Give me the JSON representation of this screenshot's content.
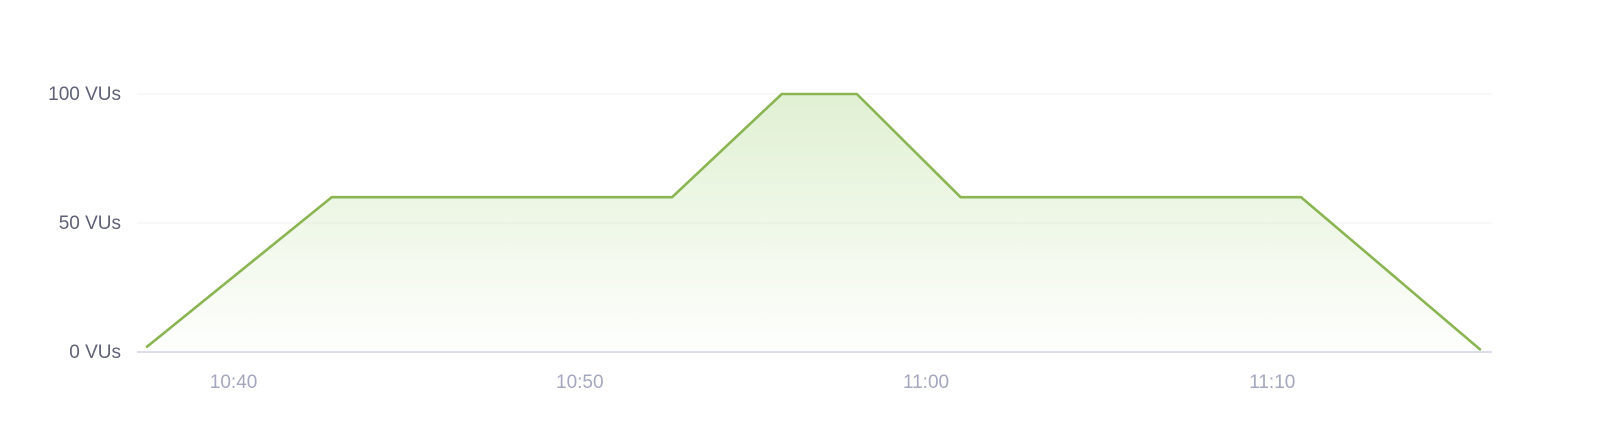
{
  "chart_data": {
    "type": "area",
    "title": "",
    "xlabel": "",
    "ylabel": "",
    "ylim": [
      0,
      100
    ],
    "y_ticks": [
      {
        "value": 0,
        "label": "0 VUs"
      },
      {
        "value": 50,
        "label": "50 VUs"
      },
      {
        "value": 100,
        "label": "100 VUs"
      }
    ],
    "x_ticks": [
      {
        "value": "10:40",
        "label": "10:40"
      },
      {
        "value": "10:50",
        "label": "10:50"
      },
      {
        "value": "11:00",
        "label": "11:00"
      },
      {
        "value": "11:10",
        "label": "11:10"
      }
    ],
    "xlim": [
      "10:37:30",
      "11:16:00"
    ],
    "grid": true,
    "legend": "none",
    "series": [
      {
        "color": "#8ab552",
        "fill_color": "#dbeecb",
        "points": [
          {
            "x": "10:37:30",
            "y": 2
          },
          {
            "x": "10:42:50",
            "y": 60
          },
          {
            "x": "10:52:40",
            "y": 60
          },
          {
            "x": "10:55:50",
            "y": 100
          },
          {
            "x": "10:58:00",
            "y": 100
          },
          {
            "x": "11:01:00",
            "y": 60
          },
          {
            "x": "11:10:50",
            "y": 60
          },
          {
            "x": "11:16:00",
            "y": 1
          }
        ]
      }
    ]
  }
}
